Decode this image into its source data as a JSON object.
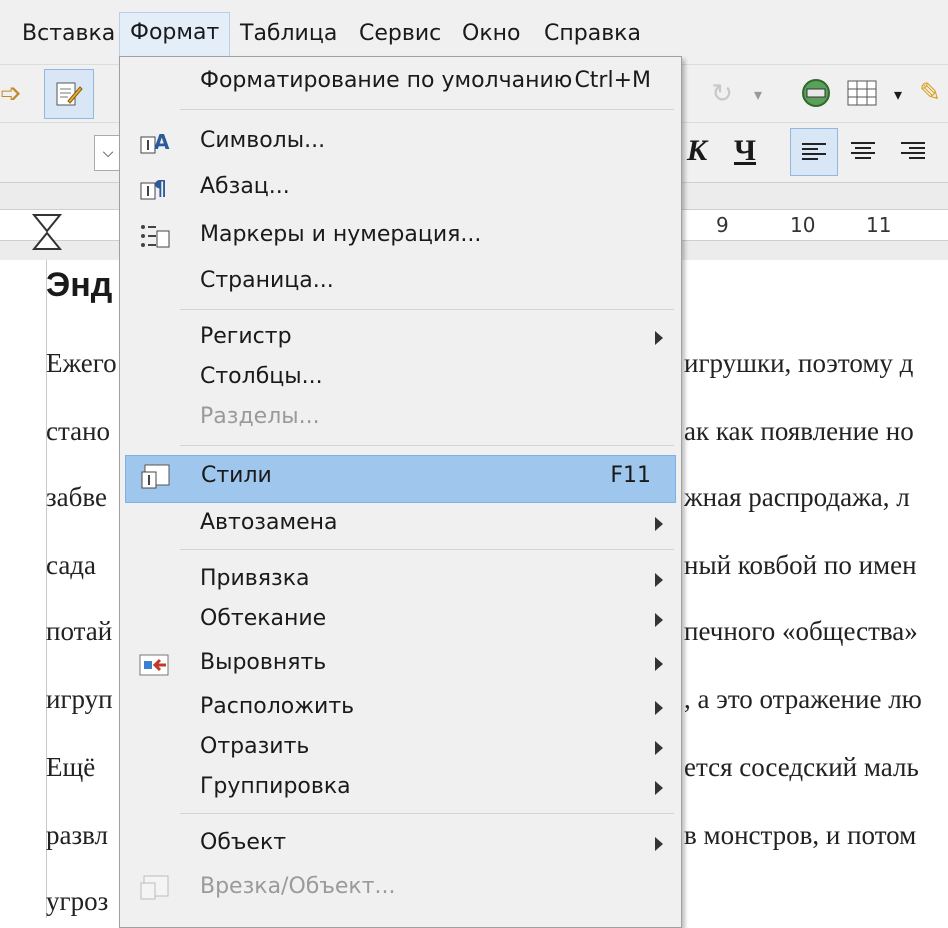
{
  "menubar": {
    "items": [
      {
        "label": "Вставка"
      },
      {
        "label": "Формат"
      },
      {
        "label": "Таблица"
      },
      {
        "label": "Сервис"
      },
      {
        "label": "Окно"
      },
      {
        "label": "Справка"
      }
    ]
  },
  "ruler": {
    "numbers": [
      "9",
      "10",
      "11"
    ]
  },
  "document": {
    "heading": "Энд",
    "lines": [
      {
        "left": "Ежего",
        "right": "игрушки, поэтому д"
      },
      {
        "left": "стано",
        "right": "ак как появление но"
      },
      {
        "left": "забве",
        "right": "жная распродажа, л"
      },
      {
        "left": "сада ",
        "right": "ный ковбой по имен"
      },
      {
        "left": "потай",
        "right": "печного «общества»"
      },
      {
        "left": "игруп",
        "right": ", а это отражение лю"
      },
      {
        "left": "Ещё ",
        "right": "ется соседский маль"
      },
      {
        "left": "развл",
        "right": "в монстров, и потом"
      },
      {
        "left": "угроз",
        "right": ""
      }
    ]
  },
  "format_menu": {
    "items": [
      {
        "label": "Форматирование по умолчанию",
        "shortcut": "Ctrl+M"
      },
      {
        "label": "Символы..."
      },
      {
        "label": "Абзац..."
      },
      {
        "label": "Маркеры и нумерация..."
      },
      {
        "label": "Страница..."
      },
      {
        "label": "Регистр"
      },
      {
        "label": "Столбцы..."
      },
      {
        "label": "Разделы..."
      },
      {
        "label": "Стили",
        "shortcut": "F11"
      },
      {
        "label": "Автозамена"
      },
      {
        "label": "Привязка"
      },
      {
        "label": "Обтекание"
      },
      {
        "label": "Выровнять"
      },
      {
        "label": "Расположить"
      },
      {
        "label": "Отразить"
      },
      {
        "label": "Группировка"
      },
      {
        "label": "Объект"
      },
      {
        "label": "Врезка/Объект..."
      }
    ]
  },
  "toolbar2": {
    "italic": "К",
    "underline": "Ч"
  },
  "colors": {
    "highlight": "#9fc7ee",
    "menu_bg": "#f0f0f0",
    "disabled": "#9a9a9a"
  }
}
